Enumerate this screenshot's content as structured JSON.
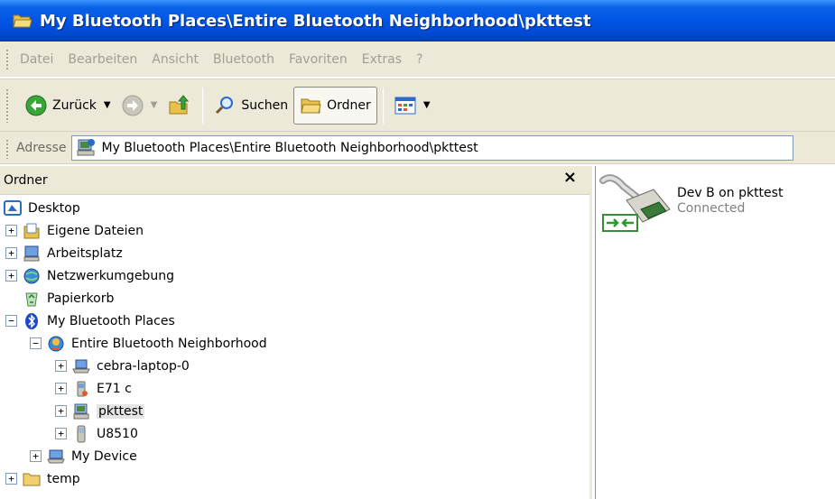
{
  "window": {
    "title": "My Bluetooth Places\\Entire Bluetooth Neighborhood\\pkttest",
    "title_icon": "folder-open-icon"
  },
  "menu": [
    "Datei",
    "Bearbeiten",
    "Ansicht",
    "Bluetooth",
    "Favoriten",
    "Extras",
    "?"
  ],
  "toolbar": {
    "back_label": "Zurück",
    "search_label": "Suchen",
    "folders_label": "Ordner"
  },
  "address": {
    "label": "Adresse",
    "value": "My Bluetooth Places\\Entire Bluetooth Neighborhood\\pkttest"
  },
  "folder_pane": {
    "title": "Ordner",
    "close": "×",
    "tree": [
      {
        "label": "Desktop",
        "icon": "desktop-icon",
        "expander": ""
      },
      {
        "label": "Eigene Dateien",
        "icon": "my-documents-icon",
        "expander": "+"
      },
      {
        "label": "Arbeitsplatz",
        "icon": "my-computer-icon",
        "expander": "+"
      },
      {
        "label": "Netzwerkumgebung",
        "icon": "network-icon",
        "expander": "+"
      },
      {
        "label": "Papierkorb",
        "icon": "recycle-bin-icon",
        "expander": ""
      },
      {
        "label": "My Bluetooth Places",
        "icon": "bluetooth-icon",
        "expander": "−"
      },
      {
        "label": "Entire Bluetooth Neighborhood",
        "icon": "bluetooth-neighborhood-icon",
        "expander": "−"
      },
      {
        "label": "cebra-laptop-0",
        "icon": "laptop-icon",
        "expander": "+"
      },
      {
        "label": "E71 c",
        "icon": "phone-icon",
        "expander": "+"
      },
      {
        "label": "pkttest",
        "icon": "bluetooth-computer-icon",
        "expander": "+",
        "selected": true
      },
      {
        "label": "U8510",
        "icon": "mobile-phone-icon",
        "expander": "+"
      },
      {
        "label": "My Device",
        "icon": "my-device-icon",
        "expander": "+"
      },
      {
        "label": "temp",
        "icon": "folder-icon",
        "expander": "+"
      }
    ]
  },
  "content": {
    "items": [
      {
        "name": "Dev B on pkttest",
        "status": "Connected",
        "icon": "serial-port-icon"
      }
    ]
  },
  "colors": {
    "titlebar": "#0055e5",
    "chrome": "#ece9d8",
    "disabled_text": "#a19f90",
    "selection": "#e5e5e5"
  }
}
